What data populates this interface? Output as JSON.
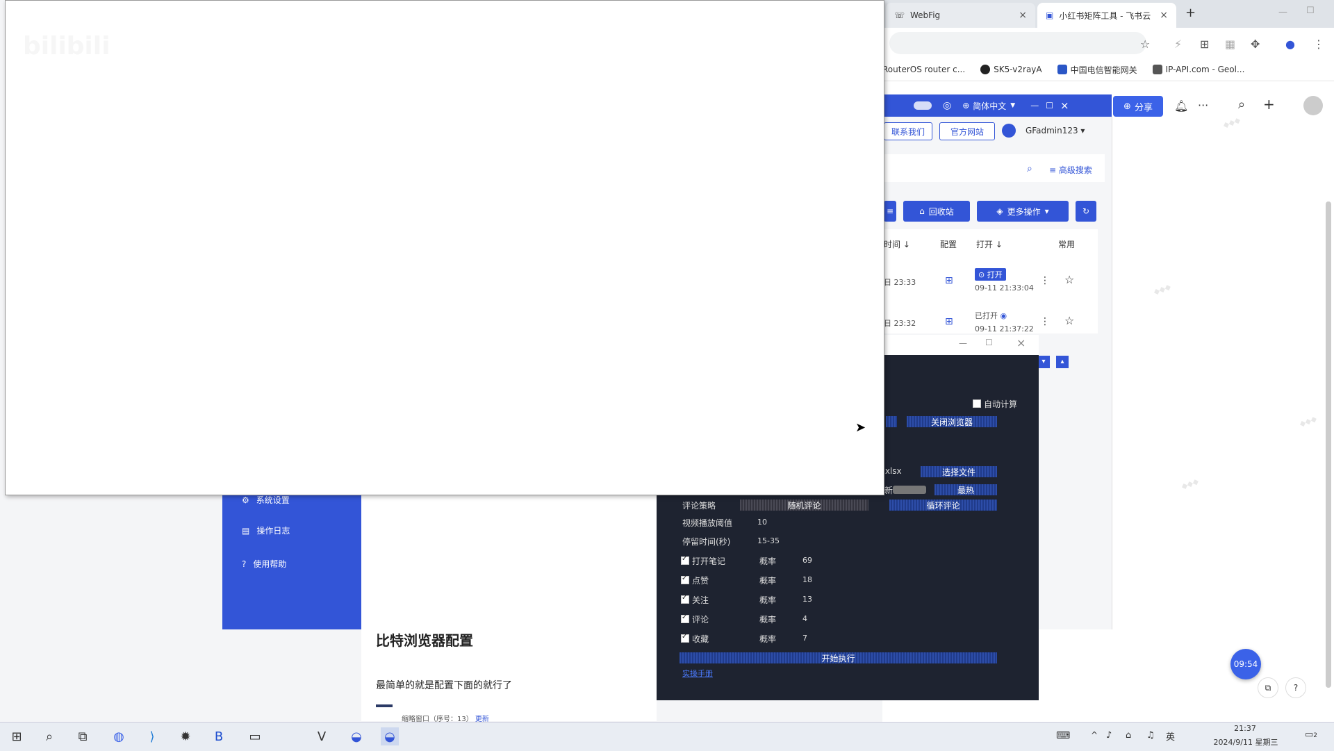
{
  "tabs": [
    {
      "label": "WebFig",
      "active": false
    },
    {
      "label": "小红书矩阵工具 - 飞书云",
      "active": true
    }
  ],
  "bookmarks": [
    "RouterOS router c...",
    "SK5-v2rayA",
    "中国电信智能网关",
    "IP-API.com - Geol..."
  ],
  "app": {
    "lang": "简体中文",
    "share": "分享",
    "contact": "联系我们",
    "official": "官方网站",
    "user": "GFadmin123",
    "advanced_search": "高级搜索",
    "recycle": "回收站",
    "more_ops": "更多操作",
    "table": {
      "headers": [
        "时间 ↓",
        "配置",
        "打开 ↓",
        "常用"
      ],
      "rows": [
        {
          "time": "日 23:33",
          "open_label": "打开",
          "open_time": "09-11 21:33:04"
        },
        {
          "time": "日 23:32",
          "open_label": "已打开",
          "open_time": "09-11 21:37:22"
        }
      ]
    }
  },
  "rpa": {
    "auto_calc": "自动计算",
    "close_browser": "关闭浏览器",
    "file_suffix": ".xlsx",
    "choose_file": "选择文件",
    "sort_new": "新",
    "sort_hot": "最热",
    "comment_strategy_label": "评论策略",
    "random_comment": "随机评论",
    "loop_comment": "循环评论",
    "video_threshold_label": "视频播放阈值",
    "video_threshold": "10",
    "dwell_label": "停留时间(秒)",
    "dwell": "15-35",
    "prob_label": "概率",
    "actions": [
      {
        "label": "打开笔记",
        "value": "69"
      },
      {
        "label": "点赞",
        "value": "18"
      },
      {
        "label": "关注",
        "value": "13"
      },
      {
        "label": "评论",
        "value": "4"
      },
      {
        "label": "收藏",
        "value": "7"
      }
    ],
    "start": "开始执行",
    "manual": "实操手册"
  },
  "nav": {
    "items": [
      "系统设置",
      "操作日志",
      "使用帮助"
    ]
  },
  "doc": {
    "heading": "比特浏览器配置",
    "para": "最简单的就是配置下面的就行了",
    "snippet": "缩略窗口（序号：13）",
    "snippet_link": "更新"
  },
  "float_timer": "09:54",
  "taskbar": {
    "time": "21:37",
    "date": "2024/9/11 星期三",
    "lang": "英",
    "notif": "2"
  },
  "colors": {
    "brand": "#3355d7",
    "dark_panel": "#1e2330"
  }
}
